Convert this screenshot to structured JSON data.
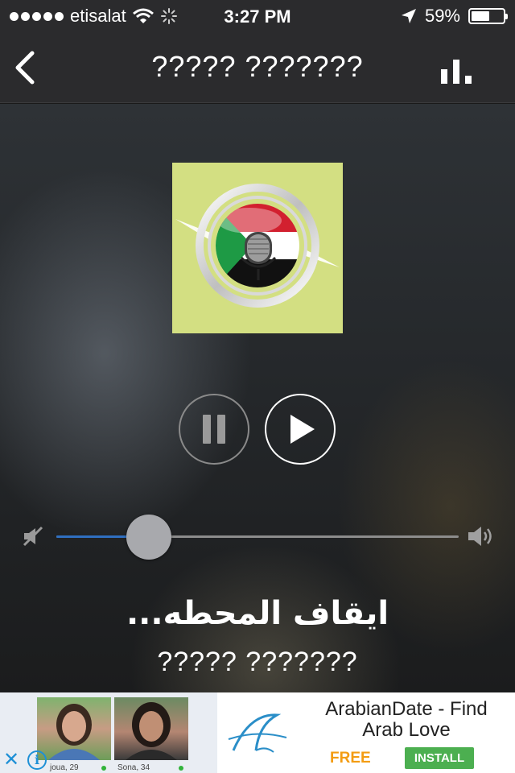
{
  "status_bar": {
    "carrier": "etisalat",
    "time": "3:27 PM",
    "battery_percent": "59%",
    "battery_level": 0.59
  },
  "nav": {
    "title": "????? ???????",
    "back_icon": "chevron-left-icon",
    "equalizer_icon": "bar-chart-icon"
  },
  "player": {
    "status_text": "ايقاف المحطه...",
    "station_name": "????? ???????",
    "volume_level": 0.23,
    "colors": {
      "accent": "#2f6fc0",
      "artwork_bg": "#d3df82"
    }
  },
  "ad": {
    "profiles": [
      {
        "label": "joua, 29"
      },
      {
        "label": "Sona, 34"
      }
    ],
    "title": "ArabianDate - Find Arab Love",
    "free_label": "FREE",
    "install_label": "INSTALL",
    "colors": {
      "free": "#f39c12",
      "install": "#4caf50",
      "close": "#1e90d6"
    }
  }
}
